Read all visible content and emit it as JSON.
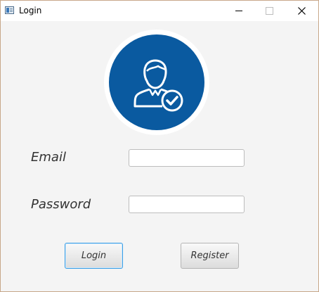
{
  "window": {
    "title": "Login",
    "icon": "app-window-icon",
    "controls": {
      "minimize_icon": "minimize-icon",
      "maximize_icon": "maximize-icon",
      "close_icon": "close-icon"
    }
  },
  "avatar": {
    "icon": "user-check-icon",
    "color": "#0a5aa0"
  },
  "form": {
    "email_label": "Email",
    "email_value": "",
    "password_label": "Password",
    "password_value": ""
  },
  "buttons": {
    "login_label": "Login",
    "register_label": "Register"
  },
  "colors": {
    "accent": "#0a5aa0",
    "focus_border": "#3a9ee6",
    "background": "#f4f4f4"
  }
}
